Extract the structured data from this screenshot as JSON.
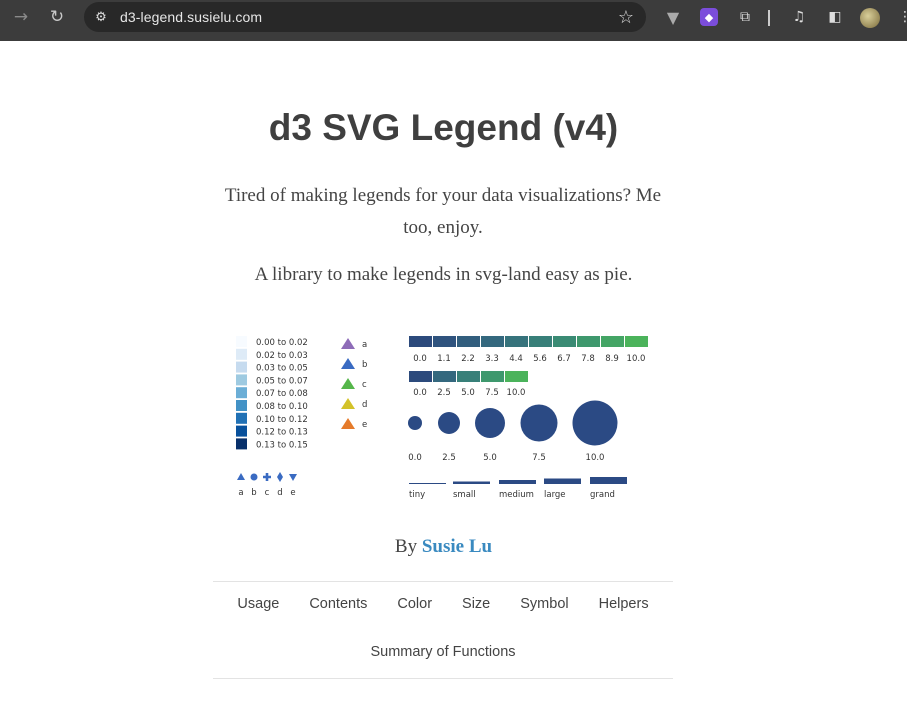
{
  "browser": {
    "url": "d3-legend.susielu.com",
    "icons": [
      "back-arrow-icon",
      "reload-icon",
      "site-info-icon",
      "bookmark-star-icon",
      "vue-devtools-icon",
      "extension-icon",
      "puzzle-icon",
      "media-control-icon",
      "side-panel-icon",
      "profile-avatar",
      "kebab-menu-icon"
    ]
  },
  "page": {
    "title": "d3 SVG Legend (v4)",
    "tagline": "Tired of making legends for your data visualizations? Me too, enjoy.",
    "subtagline": "A library to make legends in svg-land easy as pie.",
    "byline_prefix": "By",
    "author": "Susie Lu"
  },
  "legend_preview": {
    "color_scale": {
      "labels": [
        "0.00 to 0.02",
        "0.02 to 0.03",
        "0.03 to 0.05",
        "0.05 to 0.07",
        "0.07 to 0.08",
        "0.08 to 0.10",
        "0.10 to 0.12",
        "0.12 to 0.13",
        "0.13 to 0.15"
      ],
      "colors": [
        "#f7fbff",
        "#deebf7",
        "#c6dbef",
        "#9ecae1",
        "#6baed6",
        "#4292c6",
        "#2171b5",
        "#08519c",
        "#08306b"
      ]
    },
    "triangle_legend": {
      "labels": [
        "a",
        "b",
        "c",
        "d",
        "e"
      ],
      "colors": [
        "#8e6cb8",
        "#3a6bc2",
        "#55b64a",
        "#d3c22a",
        "#e57b2b"
      ]
    },
    "symbol_row": {
      "labels": [
        "a",
        "b",
        "c",
        "d",
        "e"
      ],
      "color": "#3a6bc2"
    },
    "viridis_horizontal_1": {
      "labels": [
        "0.0",
        "1.1",
        "2.2",
        "3.3",
        "4.4",
        "5.6",
        "6.7",
        "7.8",
        "8.9",
        "10.0"
      ],
      "colors": [
        "#2c4a7c",
        "#2f537e",
        "#325e7e",
        "#34687e",
        "#36737c",
        "#387f79",
        "#3a8b74",
        "#3e986d",
        "#44a565",
        "#4bb35b"
      ]
    },
    "viridis_horizontal_2": {
      "labels": [
        "0.0",
        "2.5",
        "5.0",
        "7.5",
        "10.0"
      ],
      "colors": [
        "#2c4a7c",
        "#34687e",
        "#388079",
        "#3e986d",
        "#4bb35b"
      ]
    },
    "size_circles": {
      "labels": [
        "0.0",
        "2.5",
        "5.0",
        "7.5",
        "10.0"
      ],
      "color": "#2b4a84"
    },
    "line_widths": {
      "labels": [
        "tiny",
        "small",
        "medium",
        "large",
        "grand"
      ],
      "color": "#2b4a84"
    }
  },
  "nav": {
    "items": [
      "Usage",
      "Contents",
      "Color",
      "Size",
      "Symbol",
      "Helpers"
    ],
    "second_row": "Summary of Functions"
  }
}
